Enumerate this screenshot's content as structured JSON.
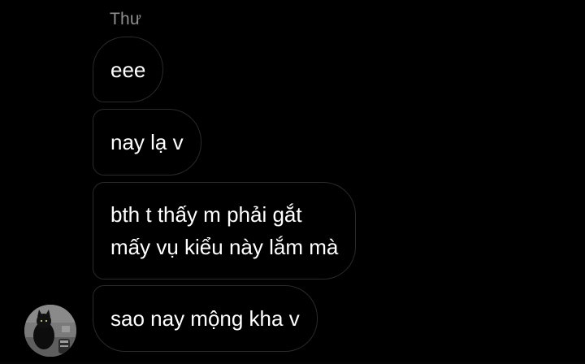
{
  "conversation": {
    "sender_name": "Thư",
    "messages": [
      {
        "lines": [
          "eee"
        ]
      },
      {
        "lines": [
          "nay lạ v"
        ]
      },
      {
        "lines": [
          "bth t thấy m phải gắt",
          "mấy vụ kiểu này lắm mà"
        ]
      },
      {
        "lines": [
          "sao nay mộng kha v"
        ]
      }
    ],
    "avatar_icon": "cat-photo-avatar"
  },
  "colors": {
    "background": "#000000",
    "bubble_border": "#2a2a2a",
    "sender_name": "#8e8e8e",
    "message_text": "#ffffff"
  }
}
